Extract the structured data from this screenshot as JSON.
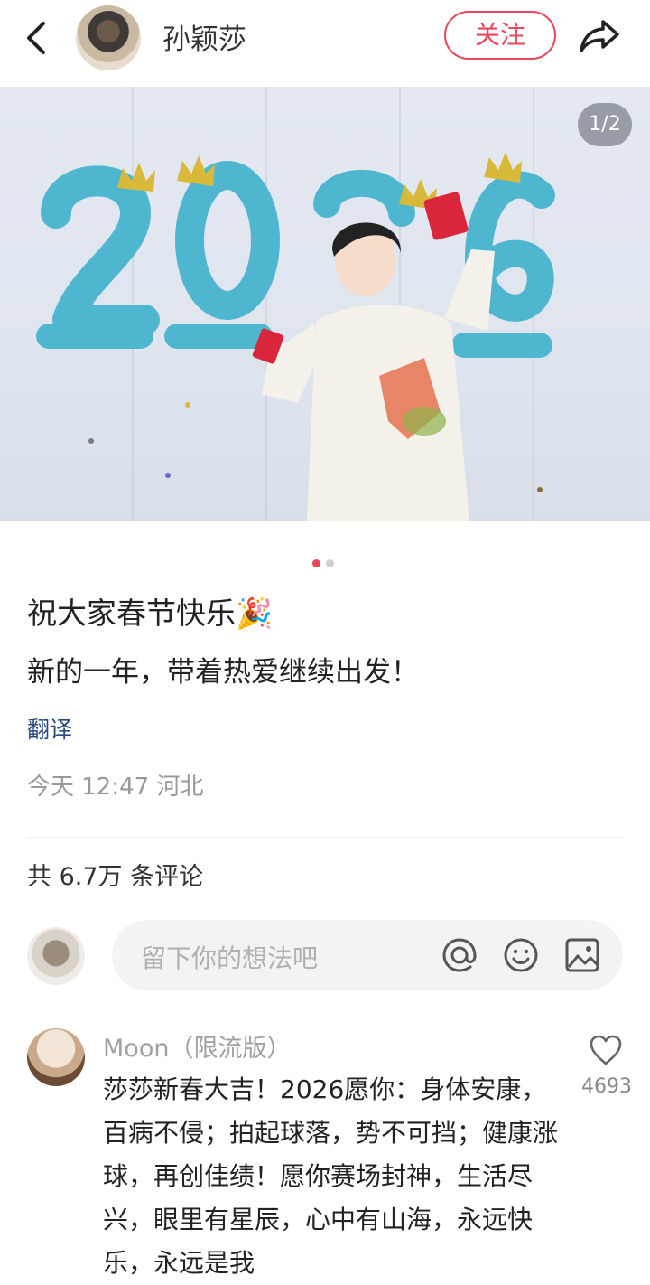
{
  "header": {
    "author_name": "孙颖莎",
    "follow_label": "关注"
  },
  "carousel": {
    "counter": "1/2",
    "total": 2,
    "current": 1
  },
  "post": {
    "title": "祝大家春节快乐🎉",
    "body": "新的一年，带着热爱继续出发！",
    "translate_label": "翻译",
    "meta": "今天 12:47 河北"
  },
  "comments_section": {
    "count_label": "共 6.7万 条评论",
    "input_placeholder": "留下你的想法吧"
  },
  "comment": {
    "user": "Moon（限流版）",
    "text": "莎莎新春大吉！2026愿你：身体安康，百病不侵；拍起球落，势不可挡；健康涨球，再创佳绩！愿你赛场封神，生活尽兴，眼里有星辰，心中有山海，永远快乐，永远是我",
    "likes": "4693"
  },
  "colors": {
    "accent_red": "#e8465a",
    "balloon_blue": "#4fb6cf",
    "crown_gold": "#d9b93a",
    "link_blue": "#2a4a7a"
  },
  "icons": [
    "back-icon",
    "share-icon",
    "at-icon",
    "emoji-icon",
    "image-icon",
    "heart-icon"
  ]
}
